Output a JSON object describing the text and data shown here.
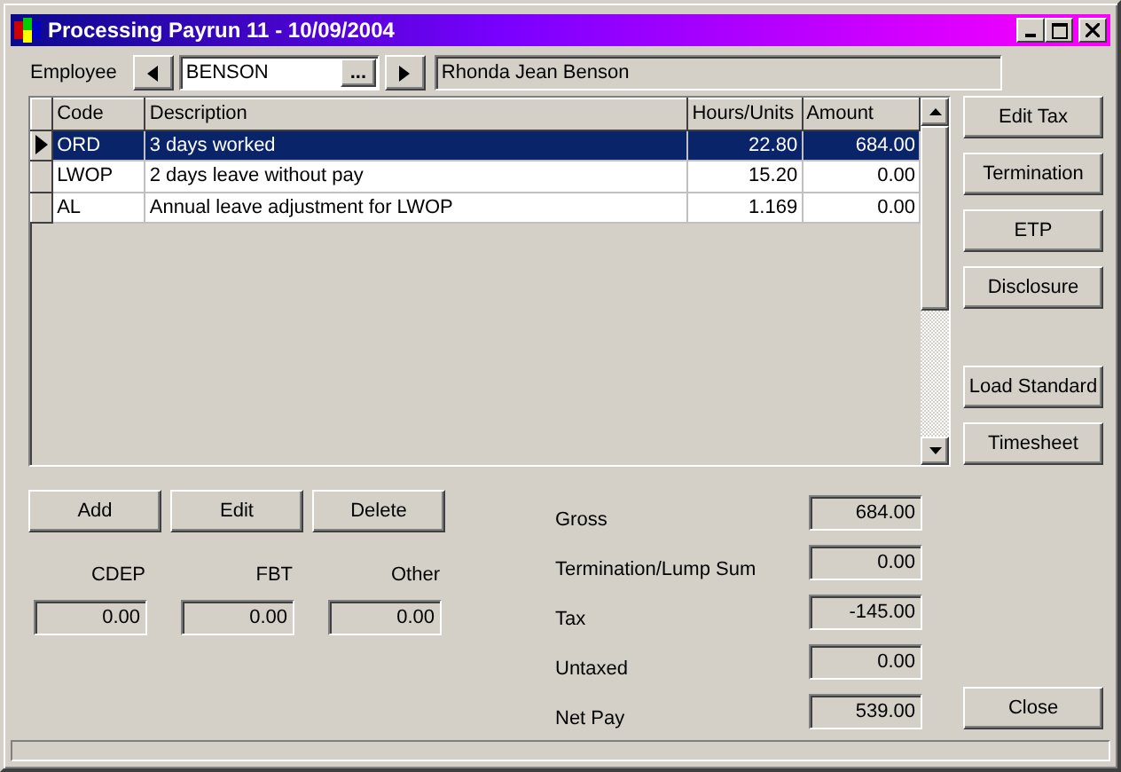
{
  "window": {
    "title": "Processing Payrun 11 - 10/09/2004"
  },
  "employee": {
    "label": "Employee",
    "code": "BENSON",
    "browse": "...",
    "name": "Rhonda Jean Benson"
  },
  "table": {
    "columns": [
      "Code",
      "Description",
      "Hours/Units",
      "Amount"
    ],
    "rows": [
      {
        "cells": [
          "ORD",
          "3 days worked",
          "22.80",
          "684.00"
        ],
        "selected": true
      },
      {
        "cells": [
          "LWOP",
          "2 days leave without pay",
          "15.20",
          "0.00"
        ],
        "selected": false
      },
      {
        "cells": [
          "AL",
          "Annual leave adjustment for LWOP",
          "1.169",
          "0.00"
        ],
        "selected": false
      }
    ]
  },
  "row_buttons": [
    "Add",
    "Edit",
    "Delete"
  ],
  "extras": [
    {
      "label": "CDEP",
      "value": "0.00"
    },
    {
      "label": "FBT",
      "value": "0.00"
    },
    {
      "label": "Other",
      "value": "0.00"
    }
  ],
  "summary": [
    {
      "label": "Gross",
      "value": "684.00"
    },
    {
      "label": "Termination/Lump Sum",
      "value": "0.00"
    },
    {
      "label": "Tax",
      "value": "-145.00"
    },
    {
      "label": "Untaxed",
      "value": "0.00"
    },
    {
      "label": "Net Pay",
      "value": "539.00"
    }
  ],
  "side_button_groups": [
    [
      "Edit Tax",
      "Termination",
      "ETP",
      "Disclosure"
    ],
    [
      "Load Standard",
      "Timesheet"
    ]
  ],
  "close_button": "Close"
}
